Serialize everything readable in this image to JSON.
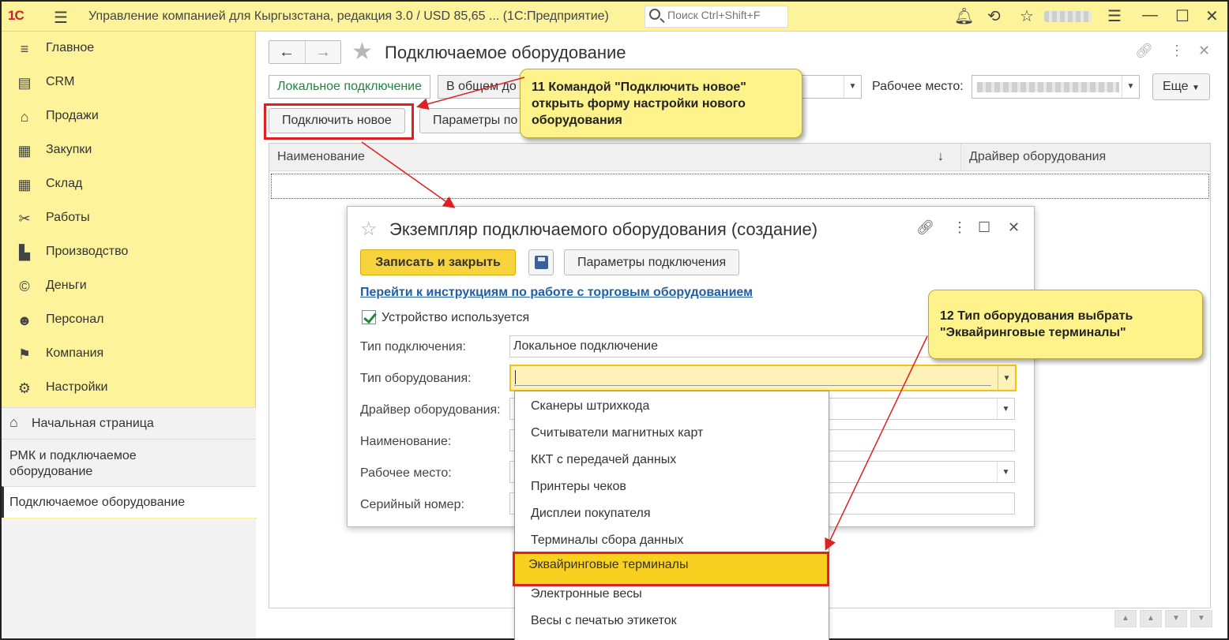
{
  "titlebar": {
    "logo": "1С",
    "app_title": "Управление компанией для Кыргызстана, редакция 3.0 / USD 85,65 ...  (1С:Предприятие)",
    "search_placeholder": "Поиск Ctrl+Shift+F"
  },
  "sidebar": {
    "items": [
      {
        "label": "Главное",
        "icon": "menu-lines-icon"
      },
      {
        "label": "CRM",
        "icon": "crm-card-icon"
      },
      {
        "label": "Продажи",
        "icon": "basket-icon"
      },
      {
        "label": "Закупки",
        "icon": "cart-icon"
      },
      {
        "label": "Склад",
        "icon": "warehouse-grid-icon"
      },
      {
        "label": "Работы",
        "icon": "tools-icon"
      },
      {
        "label": "Производство",
        "icon": "factory-icon"
      },
      {
        "label": "Деньги",
        "icon": "coin-icon"
      },
      {
        "label": "Персонал",
        "icon": "people-icon"
      },
      {
        "label": "Компания",
        "icon": "flag-icon"
      },
      {
        "label": "Настройки",
        "icon": "gear-icon"
      }
    ],
    "home": "Начальная страница",
    "section1": "РМК и подключаемое оборудование",
    "section2": "Подключаемое оборудование"
  },
  "page": {
    "title": "Подключаемое оборудование",
    "tab_local": "Локальное подключение",
    "tab_shared": "В общем до",
    "workplace_label": "Рабочее место:",
    "more": "Еще",
    "connect_new": "Подключить новое",
    "params": "Параметры по",
    "col_name": "Наименование",
    "col_driver": "Драйвер оборудования"
  },
  "dialog": {
    "title": "Экземпляр подключаемого оборудования (создание)",
    "save_close": "Записать и закрыть",
    "conn_params": "Параметры подключения",
    "link": "Перейти к инструкциям по работе с торговым оборудованием",
    "device_used": "Устройство используется",
    "fields": {
      "conn_type_label": "Тип подключения:",
      "conn_type_value": "Локальное подключение",
      "equip_type_label": "Тип оборудования:",
      "driver_label": "Драйвер оборудования:",
      "name_label": "Наименование:",
      "workplace_label": "Рабочее место:",
      "serial_label": "Серийный номер:"
    }
  },
  "dropdown": {
    "options": [
      "Сканеры штрихкода",
      "Считыватели магнитных карт",
      "ККТ с передачей данных",
      "Принтеры чеков",
      "Дисплеи покупателя",
      "Терминалы сбора данных",
      "Эквайринговые терминалы",
      "Электронные весы",
      "Весы с печатью этикеток"
    ],
    "selected_index": 6
  },
  "callouts": {
    "c11": "11 Командой \"Подключить новое\" открыть форму настройки нового оборудования",
    "c12": "12 Тип оборудования выбрать \"Эквайринговые терминалы\""
  },
  "colors": {
    "accent_yellow": "#fdf39b",
    "highlight_red": "#e02020",
    "selected_bg": "#f8d020"
  }
}
